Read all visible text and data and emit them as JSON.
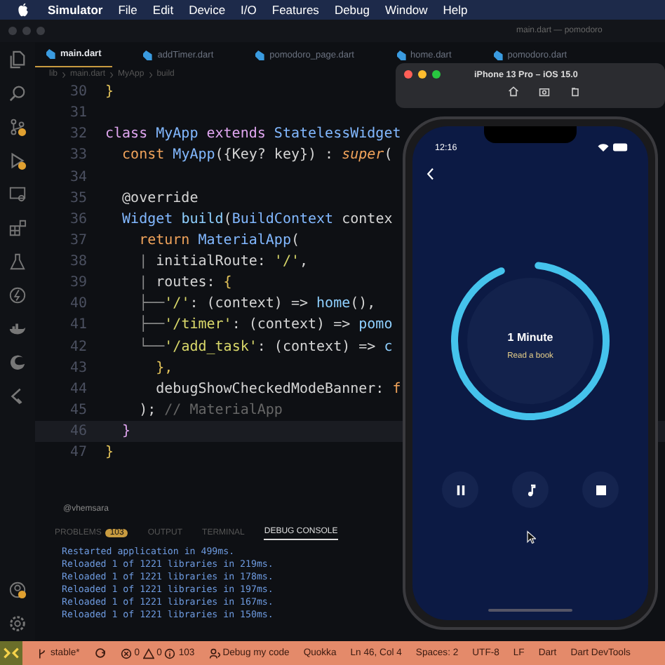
{
  "menu_bar": {
    "app": "Simulator",
    "items": [
      "File",
      "Edit",
      "Device",
      "I/O",
      "Features",
      "Debug",
      "Window",
      "Help"
    ]
  },
  "editor": {
    "title": "main.dart — pomodoro",
    "tabs": [
      {
        "label": "main.dart",
        "selected": true
      },
      {
        "label": "addTimer.dart",
        "selected": false
      },
      {
        "label": "pomodoro_page.dart",
        "selected": false
      },
      {
        "label": "home.dart",
        "selected": false
      },
      {
        "label": "pomodoro.dart",
        "selected": false
      }
    ],
    "breadcrumb": [
      "lib",
      "main.dart",
      "MyApp",
      "build"
    ],
    "lines": [
      {
        "num": "30",
        "current": false,
        "tokens": [
          {
            "t": "}",
            "kind": "brace"
          }
        ]
      },
      {
        "num": "31",
        "current": false
      },
      {
        "num": "32",
        "current": false,
        "tokens": [
          {
            "t": "class ",
            "kind": "kw"
          },
          {
            "t": "MyApp ",
            "kind": "type"
          },
          {
            "t": "extends ",
            "kind": "kw"
          },
          {
            "t": "StatelessWidget",
            "kind": "type"
          }
        ]
      },
      {
        "num": "33",
        "current": false,
        "tokens": [
          {
            "t": "  const ",
            "kind": "kw2"
          },
          {
            "t": "MyApp",
            "kind": "type"
          },
          {
            "t": "({Key? key}) : ",
            "kind": "plain"
          },
          {
            "t": "super",
            "kind": "italic"
          },
          {
            "t": "(",
            "kind": "plain"
          }
        ]
      },
      {
        "num": "34",
        "current": false
      },
      {
        "num": "35",
        "current": false,
        "tokens": [
          {
            "t": "  @override",
            "kind": "plain"
          }
        ]
      },
      {
        "num": "36",
        "current": false,
        "tokens": [
          {
            "t": "  Widget ",
            "kind": "type"
          },
          {
            "t": "build",
            "kind": "fn"
          },
          {
            "t": "(",
            "kind": "plain"
          },
          {
            "t": "BuildContext ",
            "kind": "type"
          },
          {
            "t": "contex",
            "kind": "plain"
          }
        ]
      },
      {
        "num": "37",
        "current": false,
        "tokens": [
          {
            "t": "    return ",
            "kind": "kw2"
          },
          {
            "t": "MaterialApp",
            "kind": "type"
          },
          {
            "t": "(",
            "kind": "plain"
          }
        ]
      },
      {
        "num": "38",
        "current": false,
        "tokens": [
          {
            "t": "    | ",
            "kind": "guide"
          },
          {
            "t": "initialRoute: ",
            "kind": "plain"
          },
          {
            "t": "'/'",
            "kind": "str"
          },
          {
            "t": ",",
            "kind": "plain"
          }
        ]
      },
      {
        "num": "39",
        "current": false,
        "tokens": [
          {
            "t": "    | ",
            "kind": "guide"
          },
          {
            "t": "routes: ",
            "kind": "plain"
          },
          {
            "t": "{",
            "kind": "brace"
          }
        ]
      },
      {
        "num": "40",
        "current": false,
        "tokens": [
          {
            "t": "    ├──",
            "kind": "guide"
          },
          {
            "t": "'/'",
            "kind": "str"
          },
          {
            "t": ": (context) => ",
            "kind": "plain"
          },
          {
            "t": "home",
            "kind": "fn"
          },
          {
            "t": "(),",
            "kind": "plain"
          }
        ]
      },
      {
        "num": "41",
        "current": false,
        "tokens": [
          {
            "t": "    ├──",
            "kind": "guide"
          },
          {
            "t": "'/timer'",
            "kind": "str"
          },
          {
            "t": ": (context) => ",
            "kind": "plain"
          },
          {
            "t": "pomo",
            "kind": "fn"
          }
        ]
      },
      {
        "num": "42",
        "current": false,
        "tokens": [
          {
            "t": "    └──",
            "kind": "guide"
          },
          {
            "t": "'/add_task'",
            "kind": "str"
          },
          {
            "t": ": (context) => ",
            "kind": "plain"
          },
          {
            "t": "c",
            "kind": "fn"
          }
        ]
      },
      {
        "num": "43",
        "current": false,
        "tokens": [
          {
            "t": "      },",
            "kind": "brace"
          }
        ]
      },
      {
        "num": "44",
        "current": false,
        "tokens": [
          {
            "t": "      debugShowCheckedModeBanner: ",
            "kind": "plain"
          },
          {
            "t": "f",
            "kind": "kw2"
          }
        ]
      },
      {
        "num": "45",
        "current": false,
        "tokens": [
          {
            "t": "    ); ",
            "kind": "plain"
          },
          {
            "t": "// MaterialApp",
            "kind": "comment"
          }
        ]
      },
      {
        "num": "46",
        "current": true,
        "tokens": [
          {
            "t": "  }",
            "kind": "kw"
          }
        ]
      },
      {
        "num": "47",
        "current": false,
        "tokens": [
          {
            "t": "}",
            "kind": "brace"
          }
        ]
      }
    ],
    "author": "@vhemsara"
  },
  "panel": {
    "tabs": [
      {
        "label": "PROBLEMS",
        "badge": "103",
        "selected": false
      },
      {
        "label": "OUTPUT",
        "selected": false
      },
      {
        "label": "TERMINAL",
        "selected": false
      },
      {
        "label": "DEBUG CONSOLE",
        "selected": true
      }
    ],
    "console": [
      "Restarted application in 499ms.",
      "Reloaded 1 of 1221 libraries in 219ms.",
      "Reloaded 1 of 1221 libraries in 178ms.",
      "Reloaded 1 of 1221 libraries in 197ms.",
      "Reloaded 1 of 1221 libraries in 167ms.",
      "Reloaded 1 of 1221 libraries in 150ms."
    ]
  },
  "status_bar": [
    {
      "kind": "branch",
      "text": "stable*"
    },
    {
      "kind": "sync"
    },
    {
      "kind": "problems",
      "errors": "0",
      "warnings": "0",
      "infos": "103"
    },
    {
      "kind": "debug",
      "text": "Debug my code"
    },
    {
      "kind": "plain",
      "text": "Quokka"
    },
    {
      "kind": "plain",
      "text": "Ln 46, Col 4"
    },
    {
      "kind": "plain",
      "text": "Spaces: 2"
    },
    {
      "kind": "plain",
      "text": "UTF-8"
    },
    {
      "kind": "plain",
      "text": "LF"
    },
    {
      "kind": "plain",
      "text": "Dart"
    },
    {
      "kind": "plain",
      "text": "Dart DevTools"
    }
  ],
  "simulator": {
    "title": "iPhone 13 Pro – iOS 15.0"
  },
  "phone": {
    "time": "12:16",
    "timer": {
      "title": "1 Minute",
      "task": "Read a book",
      "level": 0.92
    }
  }
}
